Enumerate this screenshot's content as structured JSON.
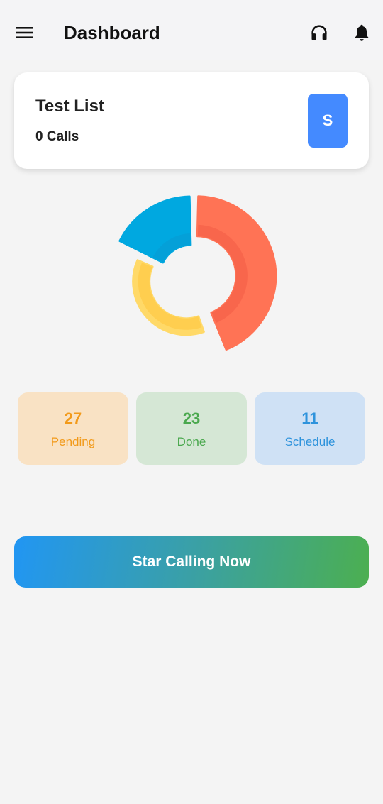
{
  "header": {
    "title": "Dashboard",
    "menu_icon": "menu-icon",
    "headset_icon": "headset-icon",
    "bell_icon": "bell-icon"
  },
  "list_card": {
    "name": "Test List",
    "calls": "0 Calls",
    "avatar_letter": "S",
    "avatar_color": "#448aff"
  },
  "chart_data": {
    "type": "pie",
    "categories": [
      "Pending",
      "Done",
      "Schedule"
    ],
    "values": [
      27,
      23,
      11
    ],
    "colors": [
      "#ff7355",
      "#ffd968",
      "#00a8e0"
    ]
  },
  "stats": [
    {
      "value": "27",
      "label": "Pending",
      "color": "#f29a1a",
      "bg": "#f9e2c4"
    },
    {
      "value": "23",
      "label": "Done",
      "color": "#4aa84e",
      "bg": "#d5e7d5"
    },
    {
      "value": "11",
      "label": "Schedule",
      "color": "#2e93dc",
      "bg": "#cfe1f5"
    }
  ],
  "cta": {
    "label": "Star Calling Now",
    "gradient_start": "#2196f3",
    "gradient_end": "#4caf50"
  }
}
